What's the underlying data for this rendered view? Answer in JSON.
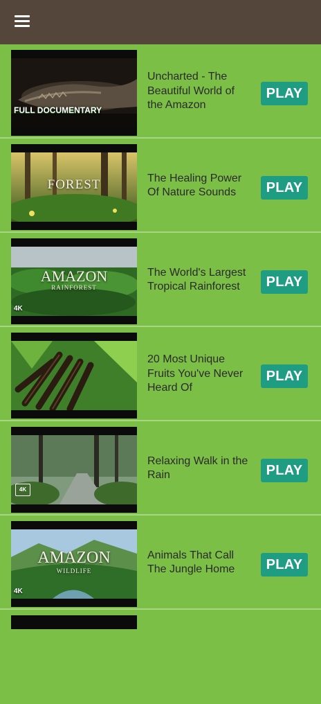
{
  "app_bar": {
    "menu_icon": "hamburger-menu-icon"
  },
  "videos": [
    {
      "title": "Uncharted - The Beautiful World of the Amazon",
      "play_label": "PLAY",
      "overlay": "FULL DOCUMENTARY"
    },
    {
      "title": "The Healing Power Of Nature Sounds",
      "play_label": "PLAY",
      "overlay": "FOREST"
    },
    {
      "title": "The World's Largest Tropical Rainforest",
      "play_label": "PLAY",
      "overlay": "AMAZON",
      "overlay_sub": "RAINFOREST",
      "badge": "4K"
    },
    {
      "title": "20 Most Unique Fruits You've Never Heard Of",
      "play_label": "PLAY"
    },
    {
      "title": "Relaxing Walk in the Rain",
      "play_label": "PLAY",
      "badge": "4K"
    },
    {
      "title": "Animals That Call The Jungle Home",
      "play_label": "PLAY",
      "overlay": "AMAZON",
      "overlay_sub": "WILDLIFE",
      "badge": "4K"
    }
  ],
  "colors": {
    "background": "#7cbf46",
    "app_bar": "#55463c",
    "play_button": "#1f9d82"
  }
}
